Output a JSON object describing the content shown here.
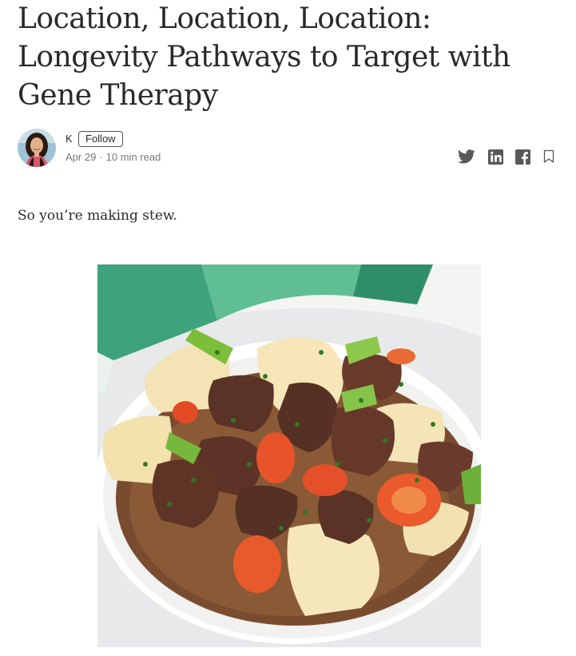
{
  "article": {
    "title": "Location, Location, Location: Longevity Pathways to Target with Gene Therapy",
    "lede": "So you’re making stew."
  },
  "author": {
    "name": "K",
    "follow_label": "Follow",
    "date": "Apr 29",
    "separator": "·",
    "read_time": "10 min read"
  },
  "share_icons": [
    "twitter-icon",
    "linkedin-icon",
    "facebook-icon",
    "bookmark-icon"
  ],
  "colors": {
    "text": "#292929",
    "meta": "#757575",
    "icon": "#595959",
    "background": "#ffffff"
  }
}
